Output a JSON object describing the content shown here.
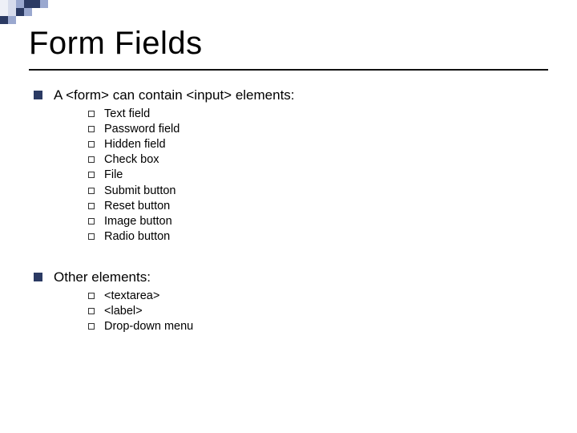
{
  "title": "Form Fields",
  "points": [
    {
      "text": "A <form> can contain <input> elements:",
      "subs": [
        "Text field",
        "Password field",
        "Hidden field",
        "Check box",
        "File",
        "Submit button",
        "Reset button",
        "Image button",
        "Radio button"
      ]
    },
    {
      "text": "Other elements:",
      "subs": [
        "<textarea>",
        "<label>",
        "Drop-down menu"
      ]
    }
  ]
}
